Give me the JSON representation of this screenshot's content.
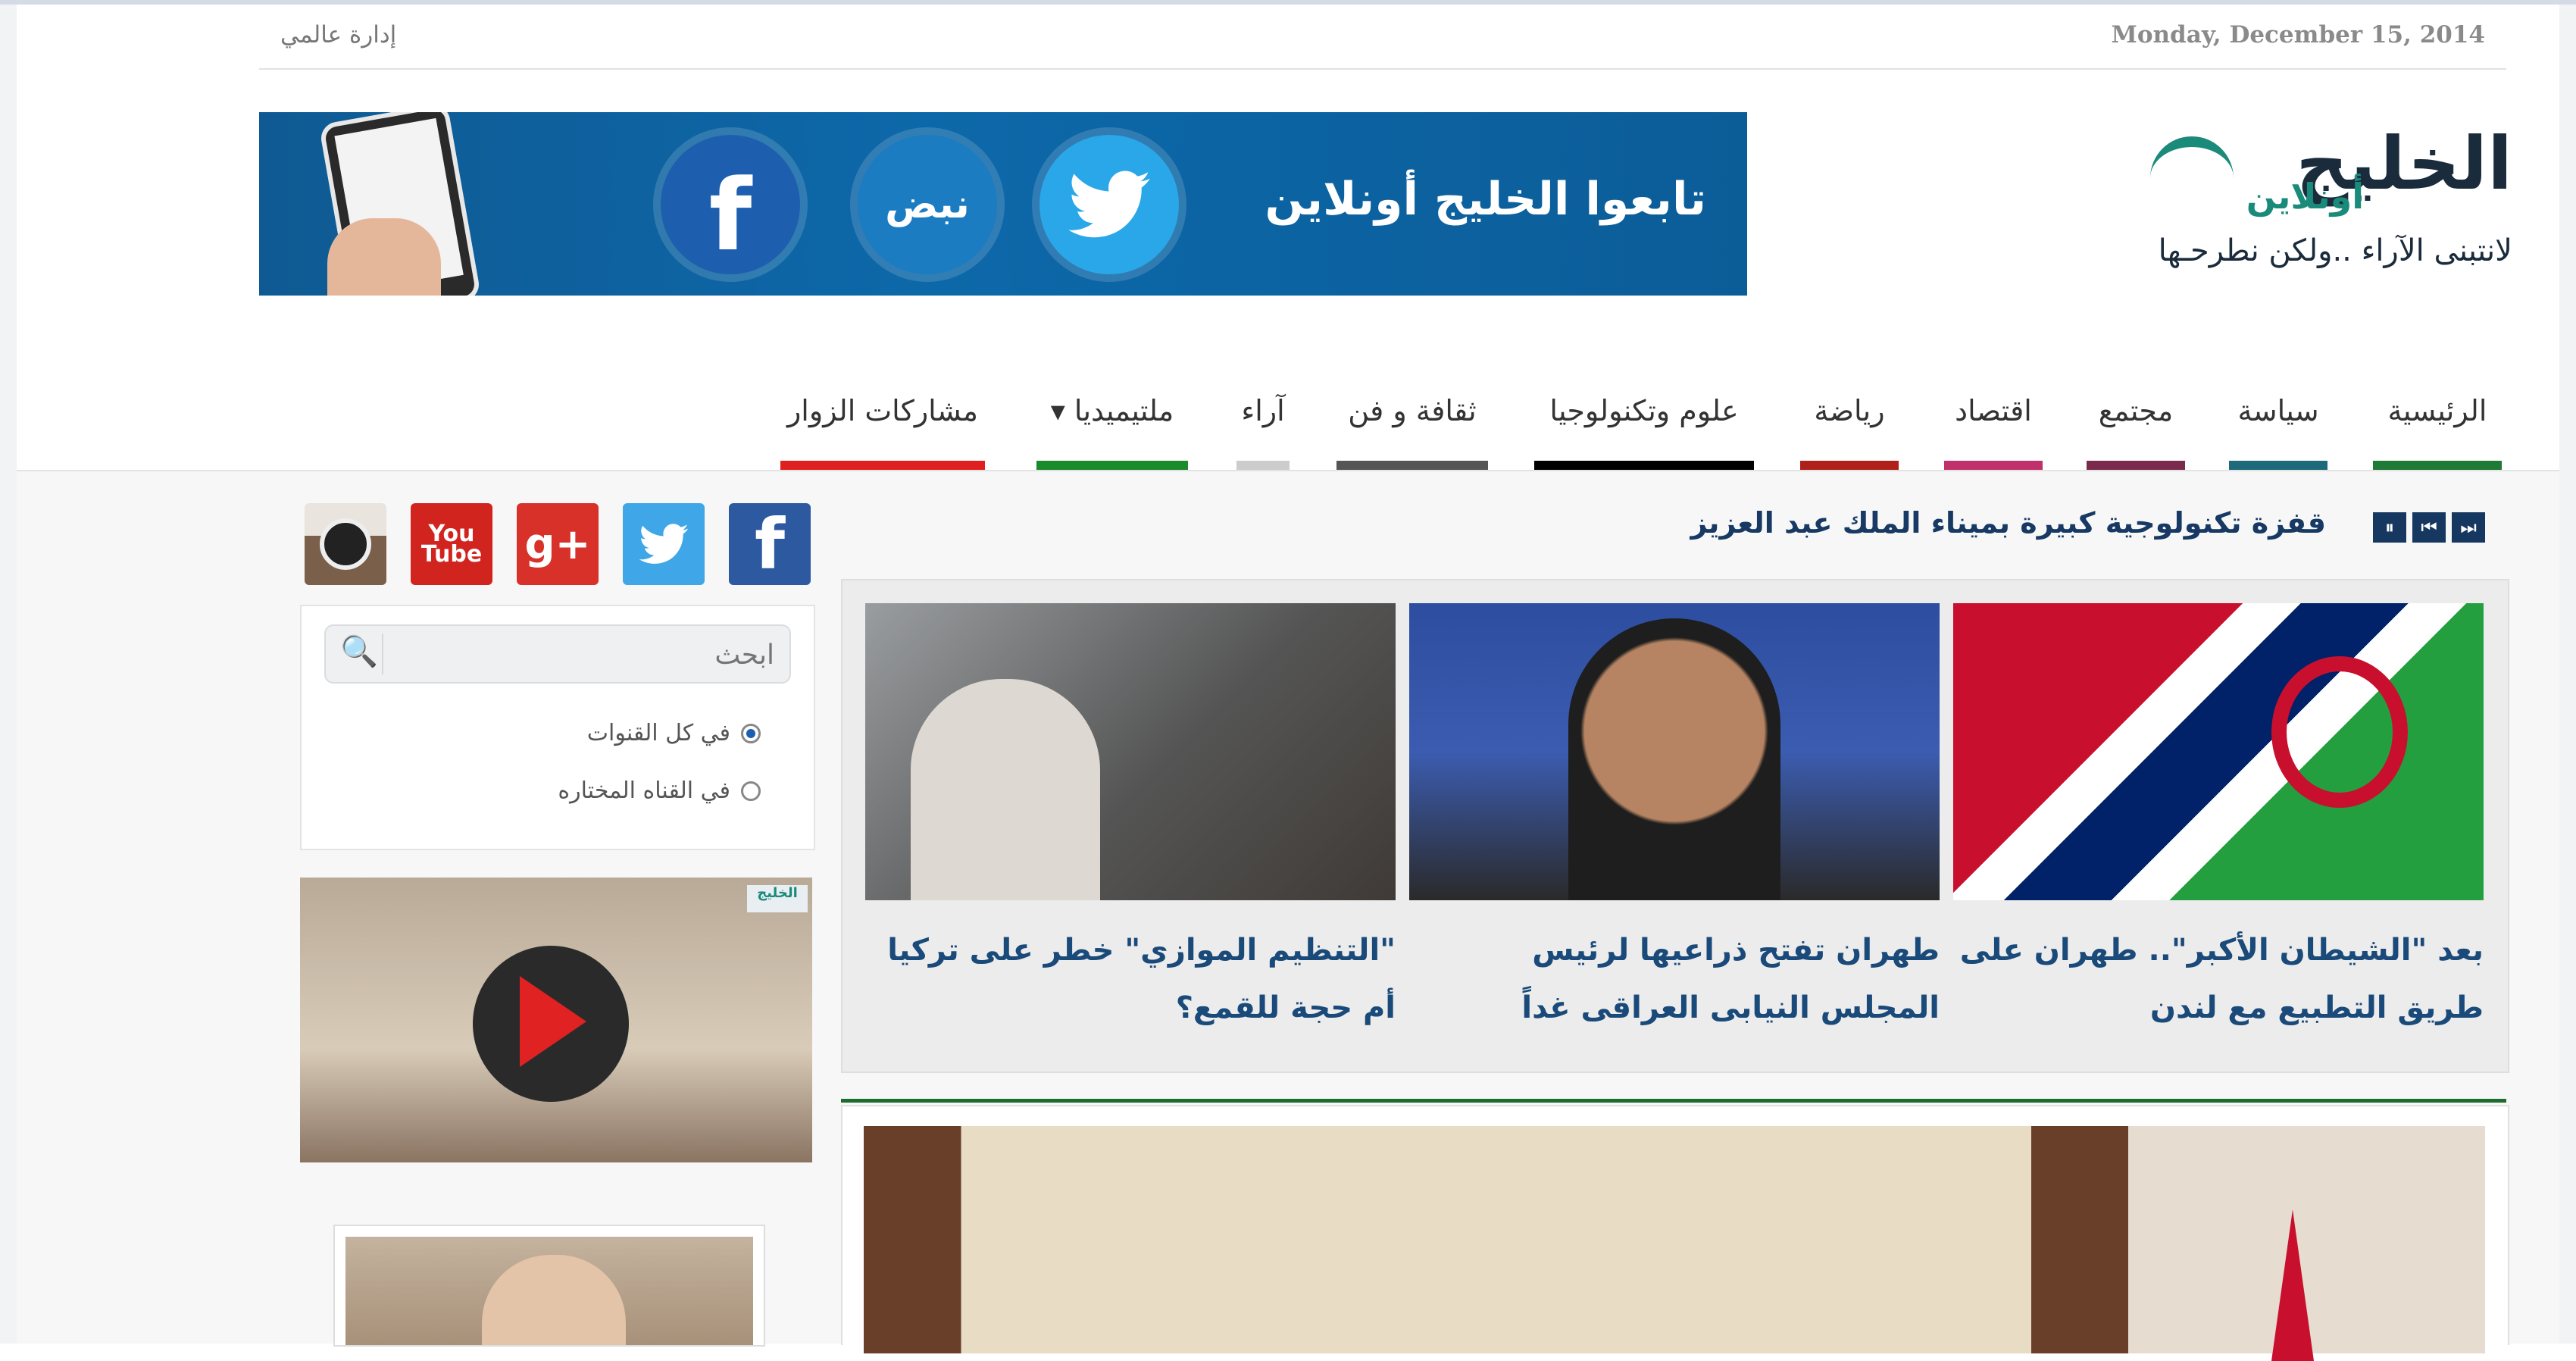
{
  "topbar": {
    "date": "Monday, December 15, 2014",
    "admin_link": "إدارة عالمي"
  },
  "banner": {
    "text": "تابعوا الخليج أونلاين",
    "nabd_label": "نبض",
    "facebook_glyph": "f",
    "twitter_glyph": "🐦"
  },
  "logo": {
    "main": "الخليج",
    "online": "أونلاين",
    "tagline": "لانتبنى الآراء ..ولكن نطرحـها"
  },
  "nav": {
    "items": [
      {
        "label": "الرئيسية",
        "color": "#1e7a34"
      },
      {
        "label": "سياسة",
        "color": "#1e6a7a"
      },
      {
        "label": "مجتمع",
        "color": "#7a2a4a"
      },
      {
        "label": "اقتصاد",
        "color": "#c0306a"
      },
      {
        "label": "رياضة",
        "color": "#b0201a"
      },
      {
        "label": "علوم وتكنولوجيا",
        "color": "#000000"
      },
      {
        "label": "ثقافة و فن",
        "color": "#555555"
      },
      {
        "label": "آراء",
        "color": "#cccccc"
      },
      {
        "label": "ملتيميديا ▾",
        "color": "#1a8a2a"
      },
      {
        "label": "مشاركات الزوار",
        "color": "#e02020"
      }
    ]
  },
  "ticker": {
    "text": "قفزة تكنولوجية كبيرة بميناء الملك عبد العزيز",
    "controls": [
      "⏸",
      "⏮",
      "⏭"
    ]
  },
  "social": {
    "icons": [
      "instagram-icon",
      "youtube-icon",
      "google-plus-icon",
      "twitter-icon",
      "facebook-icon"
    ],
    "youtube_label": "You Tube",
    "gplus_label": "g+",
    "twitter_glyph": "🐦",
    "facebook_glyph": "f"
  },
  "search": {
    "placeholder": "ابحث",
    "icon": "🔍",
    "options": [
      {
        "label": "في كل القنوات",
        "checked": true
      },
      {
        "label": "في القناه المختاره",
        "checked": false
      }
    ]
  },
  "video": {
    "logo": "الخليج"
  },
  "featured": {
    "items": [
      {
        "title": "\"التنظيم الموازي\" خطر على تركيا أم حجة للقمع؟"
      },
      {
        "title": "طهران تفتح ذراعيها لرئيس المجلس النيابى العراقى غداً"
      },
      {
        "title": "بعد \"الشيطان الأكبر\".. طهران على طريق التطبيع مع لندن"
      }
    ]
  },
  "colors": {
    "accent_navy": "#173963",
    "accent_green": "#1d6b2e"
  }
}
